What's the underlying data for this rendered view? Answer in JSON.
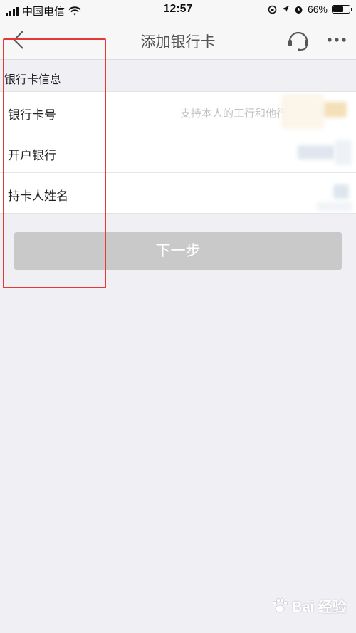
{
  "status_bar": {
    "carrier": "中国电信",
    "time": "12:57",
    "battery": "66%",
    "battery_level": 0.66
  },
  "nav": {
    "title": "添加银行卡",
    "back_icon": "back-arrow-icon",
    "service_icon": "headset-icon",
    "more_icon": "more-dots-icon"
  },
  "section": {
    "title": "银行卡信息"
  },
  "form": {
    "card_number_label": "银行卡号",
    "card_number_placeholder": "支持本人的工行和他行",
    "bank_label": "开户银行",
    "holder_label": "持卡人姓名"
  },
  "actions": {
    "next_label": "下一步"
  },
  "watermark": {
    "text": "Bai 经验"
  },
  "colors": {
    "background": "#efeff4",
    "annotation": "#e53935",
    "button_disabled": "#c9c9c9"
  }
}
